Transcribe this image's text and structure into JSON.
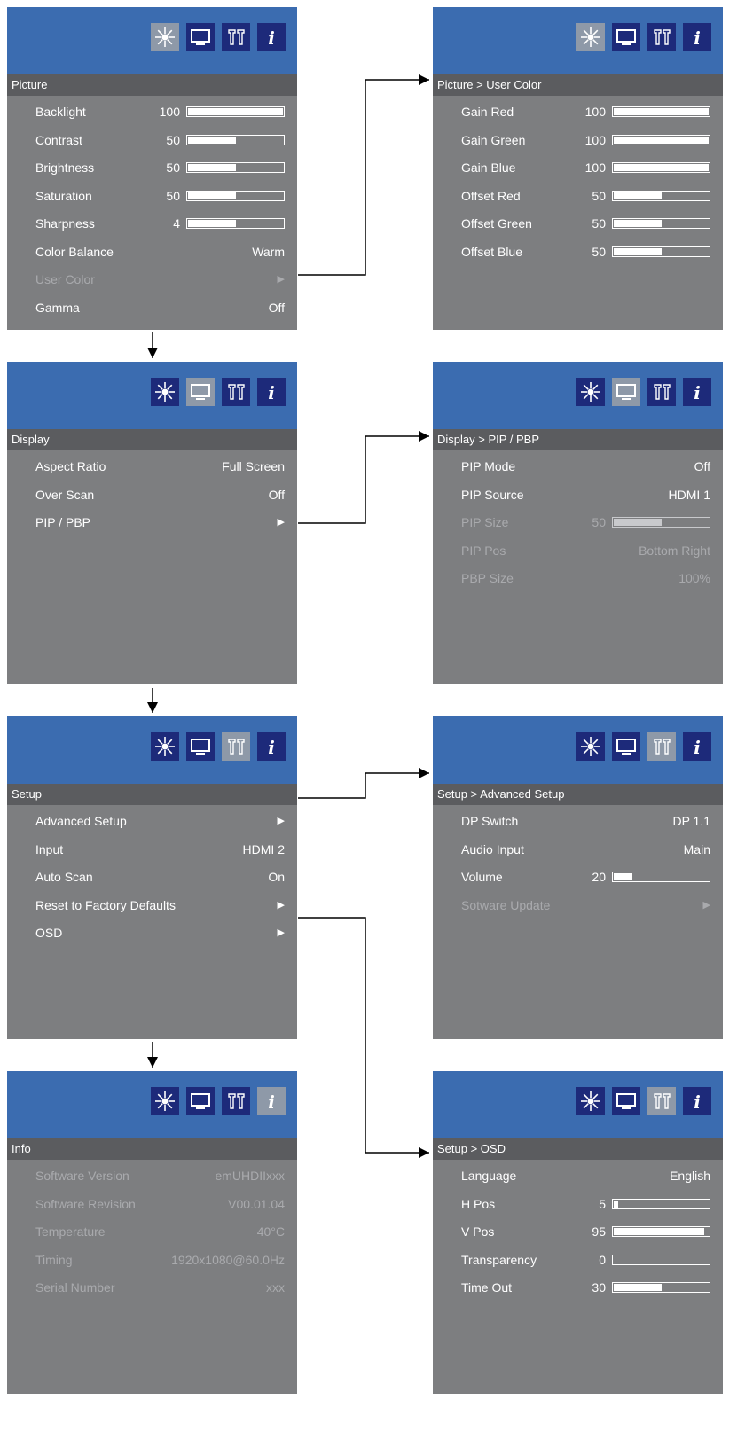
{
  "colors": {
    "top_bar": "#3b6cb0",
    "panel_bg": "#7d7e80",
    "title_bar": "#5b5c5f",
    "tab_dark": "#1d2a7a",
    "tab_selected": "#8e99a8",
    "text": "#ffffff",
    "text_dim": "#a9aaad"
  },
  "tab_icons": [
    "sun-icon",
    "monitor-icon",
    "tools-icon",
    "info-icon"
  ],
  "panels": [
    {
      "id": "picture",
      "active_tab": 0,
      "title": "Picture",
      "rows": [
        {
          "label": "Backlight",
          "num": "100",
          "level": 1.0
        },
        {
          "label": "Contrast",
          "num": "50",
          "level": 0.5
        },
        {
          "label": "Brightness",
          "num": "50",
          "level": 0.5
        },
        {
          "label": "Saturation",
          "num": "50",
          "level": 0.5
        },
        {
          "label": "Sharpness",
          "num": "4",
          "level": 0.5
        },
        {
          "label": "Color Balance",
          "value": "Warm"
        },
        {
          "label": "User Color",
          "arrow": true,
          "dim": true
        },
        {
          "label": "Gamma",
          "value": "Off"
        }
      ]
    },
    {
      "id": "user-color",
      "active_tab": 0,
      "title": "Picture > User Color",
      "rows": [
        {
          "label": "Gain Red",
          "num": "100",
          "level": 1.0
        },
        {
          "label": "Gain Green",
          "num": "100",
          "level": 1.0
        },
        {
          "label": "Gain Blue",
          "num": "100",
          "level": 1.0
        },
        {
          "label": "Offset Red",
          "num": "50",
          "level": 0.5
        },
        {
          "label": "Offset Green",
          "num": "50",
          "level": 0.5
        },
        {
          "label": "Offset Blue",
          "num": "50",
          "level": 0.5
        }
      ]
    },
    {
      "id": "display",
      "active_tab": 1,
      "title": "Display",
      "rows": [
        {
          "label": "Aspect Ratio",
          "value": "Full Screen"
        },
        {
          "label": "Over Scan",
          "value": "Off"
        },
        {
          "label": "PIP / PBP",
          "arrow": true
        }
      ]
    },
    {
      "id": "pip-pbp",
      "active_tab": 1,
      "title": "Display > PIP / PBP",
      "rows": [
        {
          "label": "PIP Mode",
          "value": "Off"
        },
        {
          "label": "PIP Source",
          "value": "HDMI 1"
        },
        {
          "label": "PIP Size",
          "num": "50",
          "level": 0.5,
          "dim": true
        },
        {
          "label": "PIP Pos",
          "value": "Bottom Right",
          "dim": true
        },
        {
          "label": "PBP Size",
          "value": "100%",
          "dim": true
        }
      ]
    },
    {
      "id": "setup",
      "active_tab": 2,
      "title": "Setup",
      "rows": [
        {
          "label": "Advanced Setup",
          "arrow": true
        },
        {
          "label": "Input",
          "value": "HDMI 2"
        },
        {
          "label": "Auto Scan",
          "value": "On"
        },
        {
          "label": "Reset to Factory Defaults",
          "arrow": true
        },
        {
          "label": "OSD",
          "arrow": true
        }
      ]
    },
    {
      "id": "advanced-setup",
      "active_tab": 2,
      "title": "Setup > Advanced Setup",
      "rows": [
        {
          "label": "DP Switch",
          "value": "DP 1.1"
        },
        {
          "label": "Audio Input",
          "value": "Main"
        },
        {
          "label": "Volume",
          "num": "20",
          "level": 0.2
        },
        {
          "label": "Sotware Update",
          "arrow": true,
          "dim": true
        }
      ]
    },
    {
      "id": "info",
      "active_tab": 3,
      "title": "Info",
      "rows": [
        {
          "label": "Software Version",
          "value": "emUHDIIxxx",
          "dim": true
        },
        {
          "label": "Software Revision",
          "value": "V00.01.04",
          "dim": true
        },
        {
          "label": "Temperature",
          "value": "40°C",
          "dim": true
        },
        {
          "label": "Timing",
          "value": "1920x1080@60.0Hz",
          "dim": true
        },
        {
          "label": "Serial Number",
          "value": "xxx",
          "dim": true
        }
      ]
    },
    {
      "id": "osd",
      "active_tab": 2,
      "title": "Setup > OSD",
      "rows": [
        {
          "label": "Language",
          "value": "English"
        },
        {
          "label": "H Pos",
          "num": "5",
          "level": 0.05
        },
        {
          "label": "V Pos",
          "num": "95",
          "level": 0.95
        },
        {
          "label": "Transparency",
          "num": "0",
          "level": 0.0
        },
        {
          "label": "Time Out",
          "num": "30",
          "level": 0.5
        }
      ]
    }
  ],
  "arrow_glyph": "▶"
}
